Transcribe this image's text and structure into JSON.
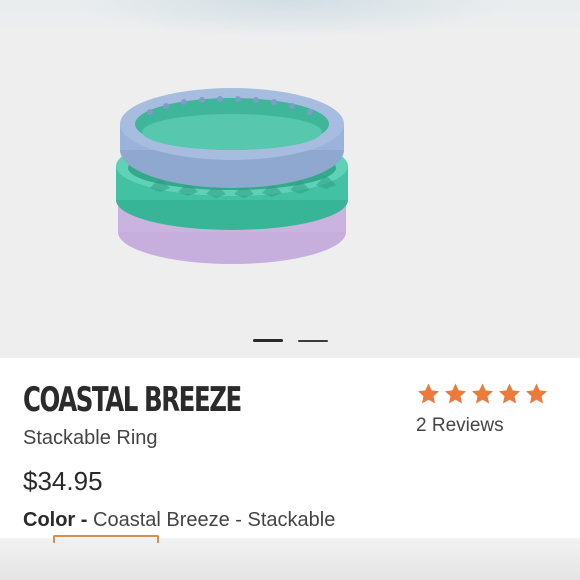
{
  "product": {
    "title": "COASTAL BREEZE",
    "subtitle": "Stackable Ring",
    "price": "$34.95",
    "color_label": "Color -",
    "color_value": "Coastal Breeze - Stackable"
  },
  "rating": {
    "stars": 5,
    "max_stars": 5,
    "reviews_label": "2 Reviews",
    "star_color": "#ec7a3a"
  },
  "gallery": {
    "image": "ring-stack-image",
    "slide_count": 2,
    "active_slide": 1
  },
  "colors": {
    "ring_blue": "#9db5d6",
    "ring_teal": "#4cc4a8",
    "ring_lavender": "#c8b2de",
    "accent": "#e08a4c"
  }
}
